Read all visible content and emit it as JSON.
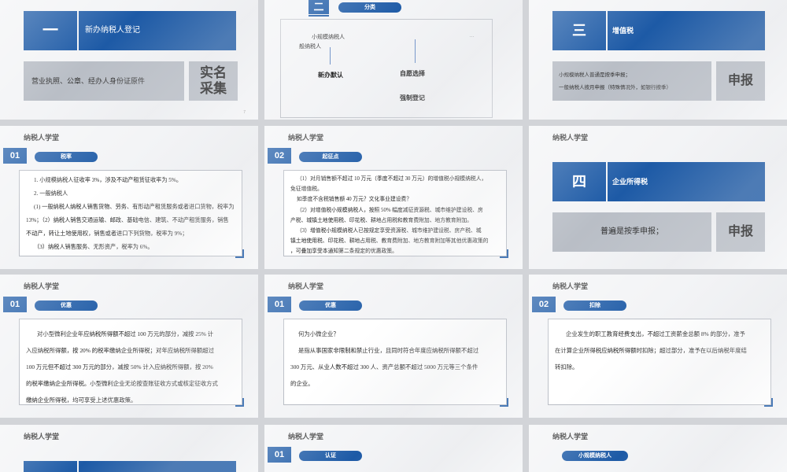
{
  "s1": {
    "num": "一",
    "title": "新办纳税人登记",
    "desc": "营业执照、公章、经办人身份证原件",
    "big1": "实名",
    "big2": "采集",
    "page": "7"
  },
  "s2": {
    "num": "二",
    "pill": "分类",
    "l1": "小规模纳税人",
    "l2": "般纳税人",
    "dots": "…",
    "a": "新办默认",
    "b": "自愿选择",
    "c": "强制登记"
  },
  "s3": {
    "num": "三",
    "title": "增值税",
    "d1": "小规模纳税人普通是按季申报；",
    "d2": "一般纳税人按月申报（特殊情况外，如银行按季）",
    "big": "申报"
  },
  "hdr": "纳税人学堂",
  "s4": {
    "num": "01",
    "pill": "税率",
    "lines": [
      "1. 小规模纳税人征收率 3%，涉及不动产租赁征收率为 5%。",
      "2. 一般纳税人",
      "(1) 一般纳税人纳税人销售货物、劳务、有形动产租赁服务或者进口货物，税率为",
      "13%；（2）纳税人销售交通运输、邮政、基础电信、建筑、不动产租赁服务，销售",
      "不动产，转让土地使用权，销售或者进口下列货物，税率为 9%；",
      "（3）纳税人销售服务、无形资产，税率为 6%。"
    ]
  },
  "s5": {
    "num": "02",
    "pill": "起征点",
    "lines": [
      "（1）对月销售额不超过 10 万元（季度不超过 30 万元）的增值税小规模纳税人，",
      "免征增值税。",
      "如季度不含税销售额 40 万元？文化事业建设费？",
      "（2）对增值税小规模纳税人，按照 50% 幅度减征资源税、城市维护建设税、房",
      "产税、城镇土地使用税、印花税、耕地占用税和教育费附加、地方教育附加。",
      "（3）增值税小规模纳税人已按规定享受资源税、城市维护建设税、房产税、城",
      "镇土地使用税、印花税、耕地占用税、教育费附加、地方教育附加等其他优惠政策的",
      "，可叠加享受本通知第二条规定的优惠政策。"
    ]
  },
  "s6": {
    "num": "四",
    "title": "企业所得税",
    "desc": "普遍是按季申报；",
    "big": "申报"
  },
  "s7": {
    "num": "01",
    "pill": "优惠",
    "lines": [
      "对小型微利企业年应纳税所得额不超过 100 万元的部分，减按 25% 计",
      "入应纳税所得额，按 20% 的税率缴纳企业所得税；对年应纳税所得额超过",
      "100 万元但不超过 300 万元的部分，减按 50% 计入应纳税所得额，按 20%",
      "的税率缴纳企业所得税。小型微利企业无论按查账征收方式或核定征收方式",
      "缴纳企业所得税，均可享受上述优惠政策。"
    ]
  },
  "s8": {
    "num": "01",
    "pill": "优惠",
    "lines": [
      "何为小微企业？",
      "是指从事国家非限制和禁止行业，且同时符合年度应纳税所得额不超过",
      "300 万元、从业人数不超过 300 人、资产总额不超过 5000 万元等三个条件",
      "的企业。"
    ]
  },
  "s9": {
    "num": "02",
    "pill": "扣除",
    "lines": [
      "企业发生的职工教育经费支出，不超过工资薪金总额 8% 的部分，准予",
      "在计算企业所得税应纳税所得额时扣除；超过部分，准予在以后纳税年度结",
      "转扣除。"
    ]
  },
  "s11": {
    "num": "01",
    "pill": "认证"
  },
  "s12": {
    "pill": "小规模纳税人"
  },
  "colors": {
    "accent": "#1d5aa6",
    "grey": "#b9bec6"
  }
}
